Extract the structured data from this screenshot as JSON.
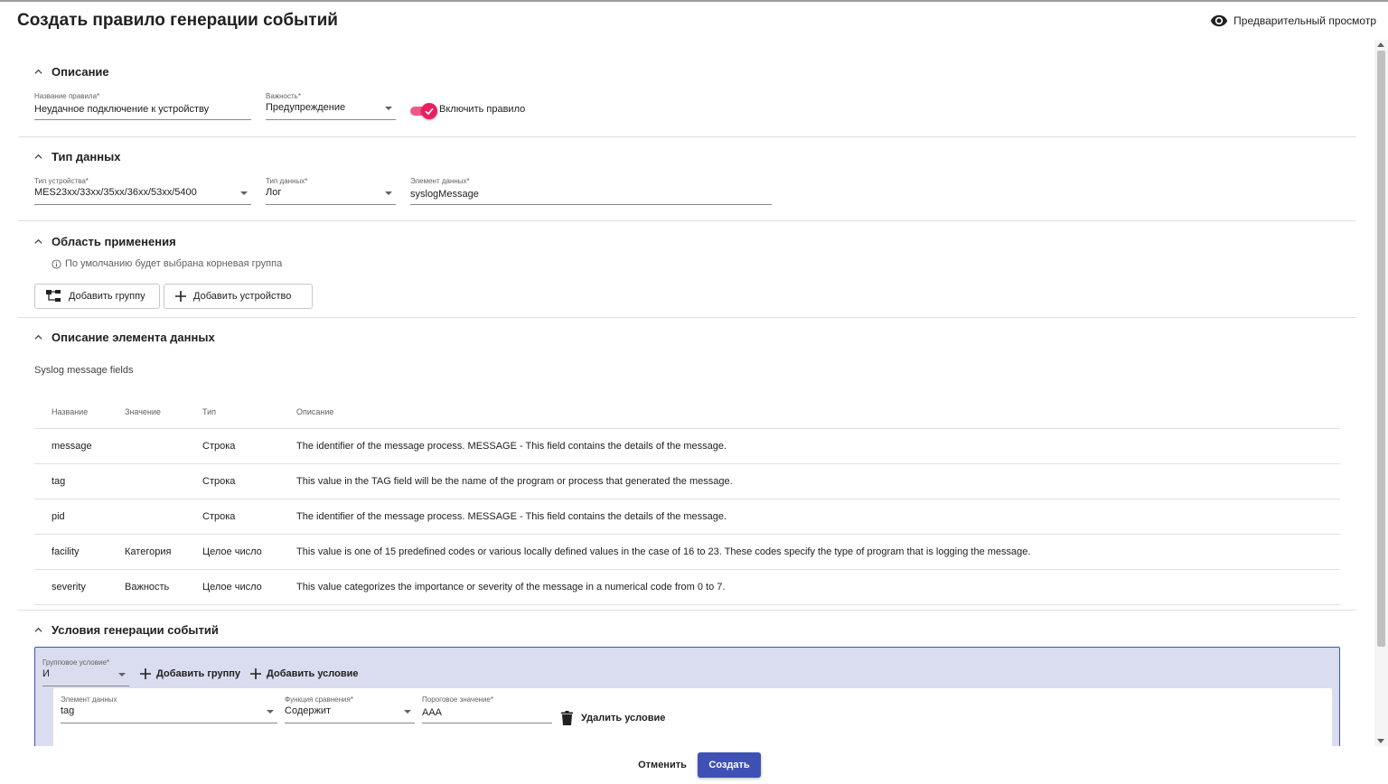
{
  "dialog": {
    "title": "Создать правило генерации событий",
    "preview_label": "Предварительный просмотр"
  },
  "sections": {
    "description": {
      "title": "Описание",
      "rule_name": {
        "label": "Название правила*",
        "value": "Неудачное подключение к устройству"
      },
      "severity": {
        "label": "Важность*",
        "value": "Предупреждение"
      },
      "enable": {
        "label": "Включить правило",
        "checked": true
      }
    },
    "data_type": {
      "title": "Тип данных",
      "device_type": {
        "label": "Тип устройства*",
        "value": "MES23xx/33xx/35xx/36xx/53xx/5400"
      },
      "data_type": {
        "label": "Тип данных*",
        "value": "Лог"
      },
      "data_element": {
        "label": "Элемент данных*",
        "value": "syslogMessage"
      }
    },
    "scope": {
      "title": "Область применения",
      "hint": "По умолчанию будет выбрана корневая группа",
      "add_group": "Добавить группу",
      "add_device": "Добавить устройство"
    },
    "element_description": {
      "title": "Описание элемента данных",
      "subtitle": "Syslog message fields",
      "columns": [
        "Название",
        "Значение",
        "Тип",
        "Описание"
      ],
      "rows": [
        [
          "message",
          "",
          "Строка",
          "The identifier of the message process. MESSAGE - This field contains the details of the message."
        ],
        [
          "tag",
          "",
          "Строка",
          "This value in the TAG field will be the name of the program or process that generated the message."
        ],
        [
          "pid",
          "",
          "Строка",
          "The identifier of the message process. MESSAGE - This field contains the details of the message."
        ],
        [
          "facility",
          "Категория",
          "Целое число",
          "This value is one of 15 predefined codes or various locally defined values in the case of 16 to 23. These codes specify the type of program that is logging the message."
        ],
        [
          "severity",
          "Важность",
          "Целое число",
          "This value categorizes the importance or severity of the message in a numerical code from 0 to 7."
        ]
      ]
    },
    "conditions": {
      "title": "Условия генерации событий",
      "group_condition": {
        "label": "Групповое условие*",
        "value": "И"
      },
      "add_group": "Добавить группу",
      "add_condition": "Добавить условие",
      "condition": {
        "data_element": {
          "label": "Элемент данных",
          "value": "tag"
        },
        "compare_fn": {
          "label": "Функция сравнения*",
          "value": "Содержит"
        },
        "threshold": {
          "label": "Пороговое значение*",
          "value": "AAA"
        },
        "delete_label": "Удалить условие"
      }
    }
  },
  "footer": {
    "cancel": "Отменить",
    "create": "Создать"
  },
  "colors": {
    "primary": "#3f51b5",
    "toggle": "#e91e63",
    "condition_bg": "#dadcef"
  }
}
